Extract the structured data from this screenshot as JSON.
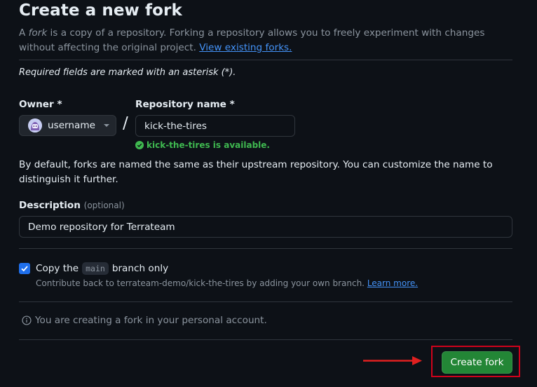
{
  "header": {
    "title": "Create a new fork",
    "desc_prefix": "A ",
    "desc_em": "fork",
    "desc_body": " is a copy of a repository. Forking a repository allows you to freely experiment with changes without affecting the original project. ",
    "view_forks_link": "View existing forks."
  },
  "form": {
    "required_note": "Required fields are marked with an asterisk (*).",
    "owner_label": "Owner *",
    "owner_value": "username",
    "slash": "/",
    "repo_label": "Repository name *",
    "repo_value": "kick-the-tires",
    "availability": "kick-the-tires is available.",
    "naming_note": "By default, forks are named the same as their upstream repository. You can customize the name to distinguish it further.",
    "description_label": "Description",
    "description_optional": "(optional)",
    "description_value": "Demo repository for Terrateam",
    "copy_prefix": "Copy the",
    "copy_branch": "main",
    "copy_suffix": "branch only",
    "copy_checked": true,
    "copy_sub": "Contribute back to terrateam-demo/kick-the-tires by adding your own branch.",
    "learn_more": "Learn more.",
    "info_note": "You are creating a fork in your personal account.",
    "submit_label": "Create fork"
  },
  "colors": {
    "background": "#0d1117",
    "accent_link": "#4493f8",
    "success": "#3fb950",
    "primary_button": "#238636",
    "annotation_red": "#d0021b"
  }
}
